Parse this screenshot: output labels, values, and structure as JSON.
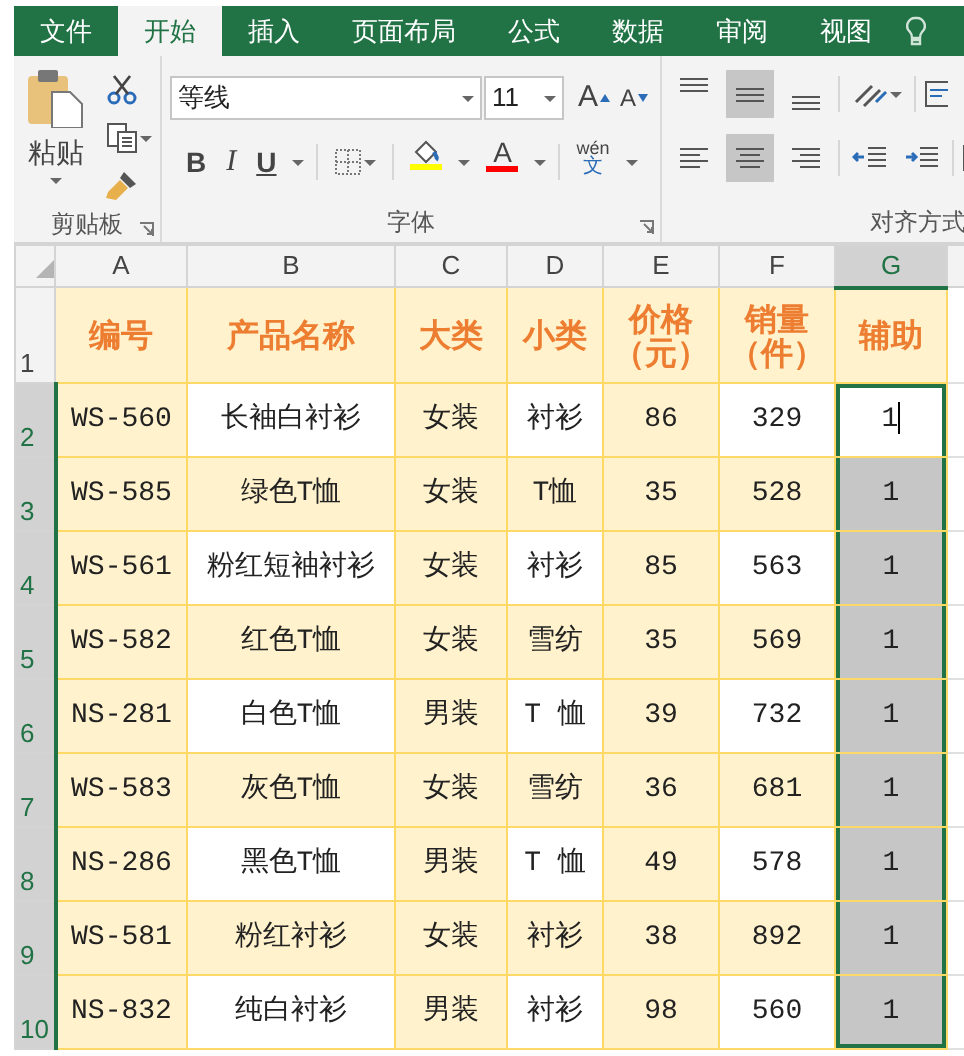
{
  "tabs": [
    {
      "label": "文件",
      "selected": false
    },
    {
      "label": "开始",
      "selected": true
    },
    {
      "label": "插入",
      "selected": false
    },
    {
      "label": "页面布局",
      "selected": false
    },
    {
      "label": "公式",
      "selected": false
    },
    {
      "label": "数据",
      "selected": false
    },
    {
      "label": "审阅",
      "selected": false
    },
    {
      "label": "视图",
      "selected": false
    }
  ],
  "ribbon": {
    "clipboard": {
      "paste_label": "粘贴",
      "group_label": "剪贴板"
    },
    "font": {
      "font_name": "等线",
      "font_size": "11",
      "grow_label": "A",
      "shrink_label": "A",
      "bold_label": "B",
      "italic_label": "I",
      "underline_label": "U",
      "font_color_label": "A",
      "phonetic_top": "wén",
      "phonetic_bottom": "文",
      "group_label": "字体"
    },
    "alignment": {
      "vertical": [
        {
          "kind": "top",
          "selected": false
        },
        {
          "kind": "middle",
          "selected": true
        },
        {
          "kind": "bottom",
          "selected": false
        }
      ],
      "horizontal": [
        {
          "kind": "left",
          "selected": false
        },
        {
          "kind": "center",
          "selected": true
        },
        {
          "kind": "right",
          "selected": false
        }
      ],
      "group_label": "对齐方式"
    }
  },
  "sheet": {
    "columns": [
      {
        "label": "A",
        "selected": false
      },
      {
        "label": "B",
        "selected": false
      },
      {
        "label": "C",
        "selected": false
      },
      {
        "label": "D",
        "selected": false
      },
      {
        "label": "E",
        "selected": false
      },
      {
        "label": "F",
        "selected": false
      },
      {
        "label": "G",
        "selected": true
      }
    ],
    "rows": [
      {
        "number": "1",
        "kind": "header",
        "selected": false,
        "cells": [
          "编号",
          "产品名称",
          "大类",
          "小类",
          "价格（元）",
          "销量（件）",
          "辅助"
        ]
      },
      {
        "number": "2",
        "kind": "data",
        "selected": true,
        "active": true,
        "banded": true,
        "cells": [
          "WS-560",
          "长袖白衬衫",
          "女装",
          "衬衫",
          "86",
          "329",
          "1"
        ]
      },
      {
        "number": "3",
        "kind": "data",
        "selected": true,
        "active": false,
        "banded": false,
        "cells": [
          "WS-585",
          "绿色T恤",
          "女装",
          "T恤",
          "35",
          "528",
          "1"
        ]
      },
      {
        "number": "4",
        "kind": "data",
        "selected": true,
        "active": false,
        "banded": true,
        "cells": [
          "WS-561",
          "粉红短袖衬衫",
          "女装",
          "衬衫",
          "85",
          "563",
          "1"
        ]
      },
      {
        "number": "5",
        "kind": "data",
        "selected": true,
        "active": false,
        "banded": false,
        "cells": [
          "WS-582",
          "红色T恤",
          "女装",
          "雪纺",
          "35",
          "569",
          "1"
        ]
      },
      {
        "number": "6",
        "kind": "data",
        "selected": true,
        "active": false,
        "banded": true,
        "cells": [
          "NS-281",
          "白色T恤",
          "男装",
          "T 恤",
          "39",
          "732",
          "1"
        ]
      },
      {
        "number": "7",
        "kind": "data",
        "selected": true,
        "active": false,
        "banded": false,
        "cells": [
          "WS-583",
          "灰色T恤",
          "女装",
          "雪纺",
          "36",
          "681",
          "1"
        ]
      },
      {
        "number": "8",
        "kind": "data",
        "selected": true,
        "active": false,
        "banded": true,
        "cells": [
          "NS-286",
          "黑色T恤",
          "男装",
          "T 恤",
          "49",
          "578",
          "1"
        ]
      },
      {
        "number": "9",
        "kind": "data",
        "selected": true,
        "active": false,
        "banded": false,
        "cells": [
          "WS-581",
          "粉红衬衫",
          "女装",
          "衬衫",
          "38",
          "892",
          "1"
        ]
      },
      {
        "number": "10",
        "kind": "data",
        "selected": true,
        "active": false,
        "banded": true,
        "cells": [
          "NS-832",
          "纯白衬衫",
          "男装",
          "衬衫",
          "98",
          "560",
          "1"
        ]
      }
    ]
  }
}
